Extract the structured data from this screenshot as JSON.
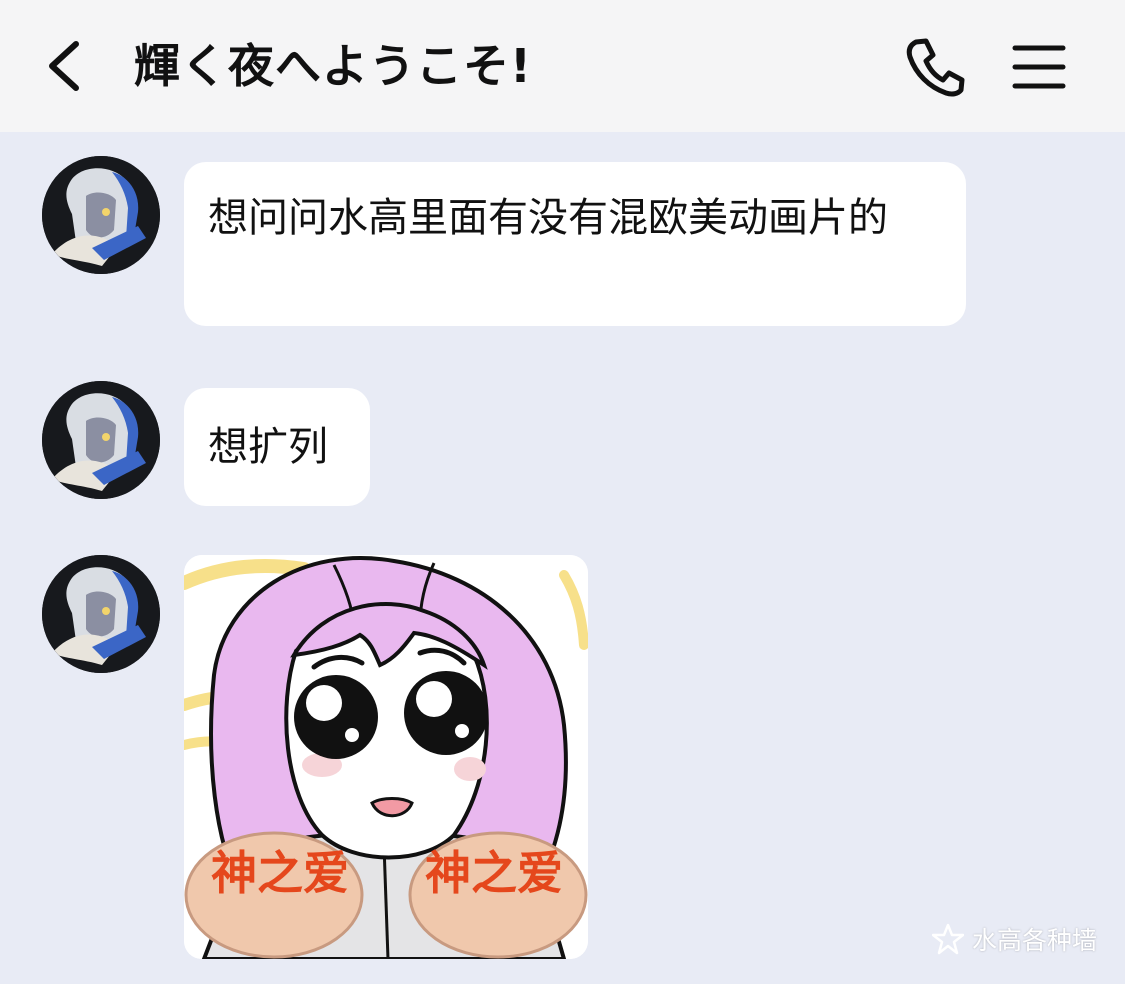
{
  "header": {
    "title": "輝く夜へようこそ!",
    "back_icon": "chevron-left-icon",
    "call_icon": "phone-icon",
    "menu_icon": "hamburger-menu-icon"
  },
  "messages": [
    {
      "type": "text",
      "text": "想问问水高里面有没有混欧美动画片的"
    },
    {
      "type": "text",
      "text": "想扩列"
    },
    {
      "type": "sticker",
      "caption_left": "神之爱",
      "caption_right": "神之爱"
    }
  ],
  "watermark": {
    "text": "水高各种墙"
  },
  "colors": {
    "header_bg": "#f5f5f6",
    "chat_bg": "#e8ebf5",
    "bubble_bg": "#ffffff",
    "sticker_hair": "#e9b8ef",
    "sticker_text": "#e5471c"
  }
}
